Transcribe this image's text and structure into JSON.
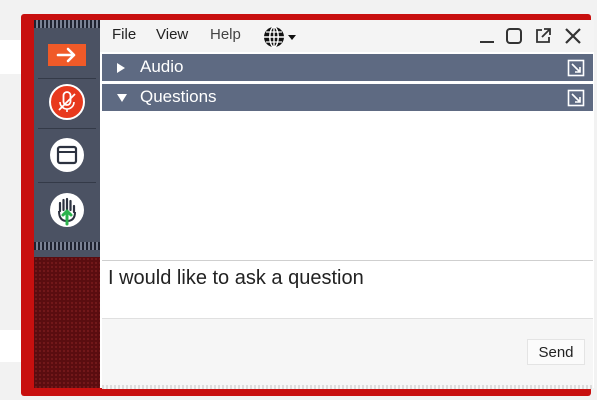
{
  "menu": {
    "file": "File",
    "view": "View",
    "help": "Help"
  },
  "icons": {
    "language": "globe-icon",
    "minimize": "minimize-icon",
    "restore": "square-icon",
    "popout": "popout-icon",
    "close": "close-icon",
    "expand": "arrow-icon",
    "mic": "microphone-muted-icon",
    "window": "window-icon",
    "raise_hand": "raise-hand-icon"
  },
  "panels": [
    {
      "label": "Audio",
      "expanded": false
    },
    {
      "label": "Questions",
      "expanded": true
    }
  ],
  "question_input": {
    "value": "I would like to ask a question"
  },
  "send_label": "Send",
  "colors": {
    "frame": "#c8100f",
    "sidebar": "#4b5263",
    "panel_header": "#5e6a82",
    "accent_orange": "#f05a28",
    "mic_red": "#e8391d",
    "hand_green": "#2bb24c"
  }
}
